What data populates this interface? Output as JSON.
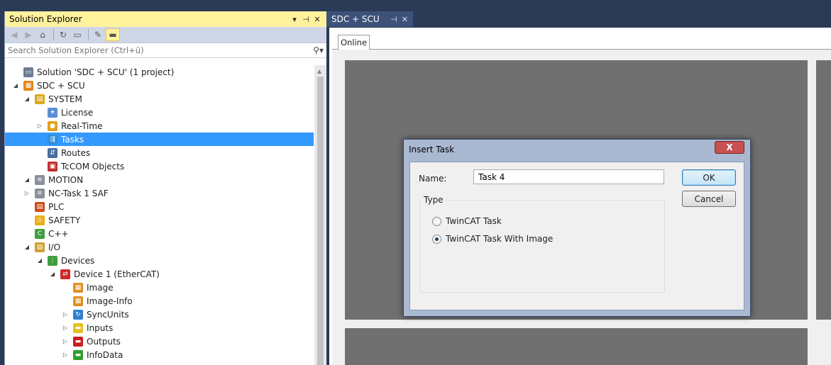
{
  "solution_explorer": {
    "title": "Solution Explorer",
    "controls": [
      "▾",
      "⊣",
      "✕"
    ],
    "search_placeholder": "Search Solution Explorer (Ctrl+ü)",
    "tree": [
      {
        "label": "Solution 'SDC + SCU' (1 project)",
        "icon": "solution-icon",
        "color": "#6b7c93"
      },
      {
        "label": "SDC + SCU",
        "icon": "project-icon",
        "color": "#e8841b"
      },
      {
        "label": "SYSTEM",
        "icon": "system-icon",
        "color": "#d9a81e"
      },
      {
        "label": "License",
        "icon": "license-icon",
        "color": "#5b8ed6"
      },
      {
        "label": "Real-Time",
        "icon": "realtime-icon",
        "color": "#e0a020"
      },
      {
        "label": "Tasks",
        "icon": "tasks-icon",
        "color": "#2f8fdd",
        "selected": true
      },
      {
        "label": "Routes",
        "icon": "routes-icon",
        "color": "#4a6f9e"
      },
      {
        "label": "TcCOM Objects",
        "icon": "tccom-icon",
        "color": "#c03030"
      },
      {
        "label": "MOTION",
        "icon": "motion-icon",
        "color": "#8a8f99"
      },
      {
        "label": "NC-Task 1 SAF",
        "icon": "nc-task-icon",
        "color": "#8a8f99"
      },
      {
        "label": "PLC",
        "icon": "plc-icon",
        "color": "#d04a1a"
      },
      {
        "label": "SAFETY",
        "icon": "safety-icon",
        "color": "#e8b020"
      },
      {
        "label": "C++",
        "icon": "cpp-icon",
        "color": "#3f9e3f"
      },
      {
        "label": "I/O",
        "icon": "io-icon",
        "color": "#d0a030"
      },
      {
        "label": "Devices",
        "icon": "devices-icon",
        "color": "#3f9e3f"
      },
      {
        "label": "Device 1 (EtherCAT)",
        "icon": "ethercat-icon",
        "color": "#d02828"
      },
      {
        "label": "Image",
        "icon": "image-icon",
        "color": "#e09020"
      },
      {
        "label": "Image-Info",
        "icon": "image-info-icon",
        "color": "#e09020"
      },
      {
        "label": "SyncUnits",
        "icon": "syncunits-icon",
        "color": "#2f7fcf"
      },
      {
        "label": "Inputs",
        "icon": "inputs-icon",
        "color": "#e8c020"
      },
      {
        "label": "Outputs",
        "icon": "outputs-icon",
        "color": "#c81e1e"
      },
      {
        "label": "InfoData",
        "icon": "infodata-icon",
        "color": "#2f9e2f"
      }
    ]
  },
  "document": {
    "tab_label": "SDC + SCU",
    "tab_pin": "⊣",
    "tab_close": "✕",
    "inner_tab": "Online"
  },
  "dialog": {
    "title": "Insert Task",
    "close_glyph": "X",
    "name_label": "Name:",
    "name_value": "Task 4",
    "ok_label": "OK",
    "cancel_label": "Cancel",
    "type_label": "Type",
    "options": [
      {
        "label": "TwinCAT Task",
        "checked": false
      },
      {
        "label": "TwinCAT Task With Image",
        "checked": true
      }
    ]
  }
}
